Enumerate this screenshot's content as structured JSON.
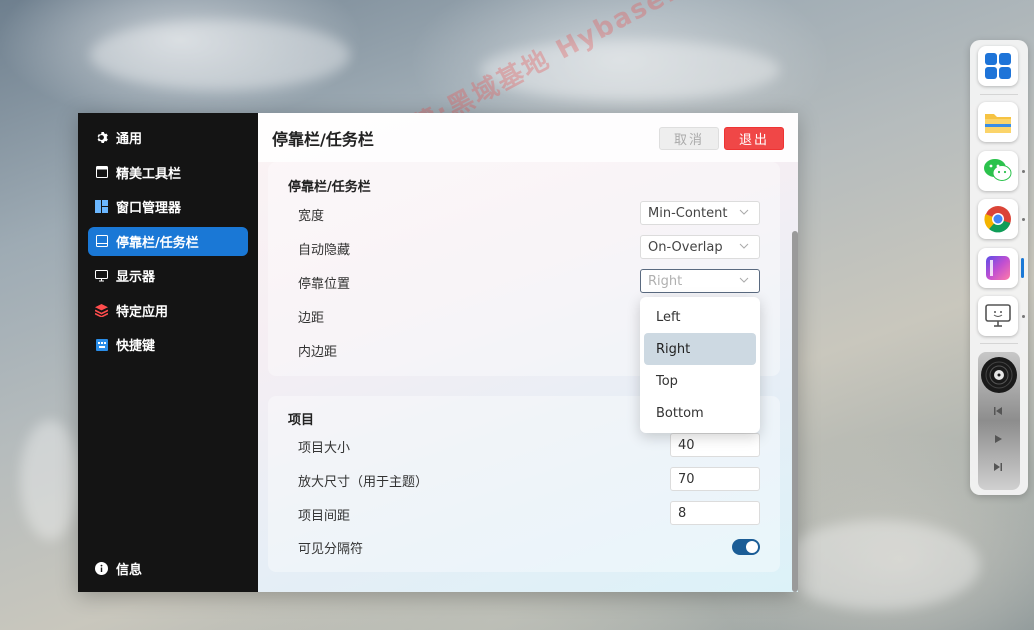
{
  "watermark": "记得收藏:黑域基地 Hybase.com",
  "sidebar": {
    "items": [
      {
        "label": "通用",
        "icon": "gear-icon"
      },
      {
        "label": "精美工具栏",
        "icon": "toolbar-icon"
      },
      {
        "label": "窗口管理器",
        "icon": "window-layout-icon"
      },
      {
        "label": "停靠栏/任务栏",
        "icon": "dock-icon",
        "active": true
      },
      {
        "label": "显示器",
        "icon": "monitor-icon"
      },
      {
        "label": "特定应用",
        "icon": "layers-icon"
      },
      {
        "label": "快捷键",
        "icon": "keyboard-icon"
      }
    ],
    "bottom": {
      "label": "信息",
      "icon": "info-icon"
    }
  },
  "header": {
    "title": "停靠栏/任务栏",
    "cancel_label": "取消",
    "exit_label": "退出"
  },
  "section_dock": {
    "title": "停靠栏/任务栏",
    "width_label": "宽度",
    "width_value": "Min-Content",
    "autohide_label": "自动隐藏",
    "autohide_value": "On-Overlap",
    "position_label": "停靠位置",
    "position_value": "Right",
    "margin_label": "边距",
    "padding_label": "内边距"
  },
  "position_dropdown": {
    "options": [
      "Left",
      "Right",
      "Top",
      "Bottom"
    ],
    "selected": "Right"
  },
  "section_items": {
    "title": "项目",
    "size_label": "项目大小",
    "size_value": "40",
    "zoom_label": "放大尺寸（用于主题）",
    "zoom_value": "70",
    "spacing_label": "项目间距",
    "spacing_value": "8",
    "separator_label": "可见分隔符",
    "separator_on": true
  },
  "colors": {
    "accent": "#1a78d6",
    "exit": "#f04747",
    "sidebar_bg": "#141414",
    "toggle_on": "#1b5d96"
  },
  "dock_apps": [
    "start-menu-icon",
    "file-explorer-icon",
    "wechat-icon",
    "chrome-icon",
    "gradient-app-icon",
    "remote-desktop-icon"
  ],
  "media_player": [
    "previous-icon",
    "play-icon",
    "next-icon"
  ]
}
